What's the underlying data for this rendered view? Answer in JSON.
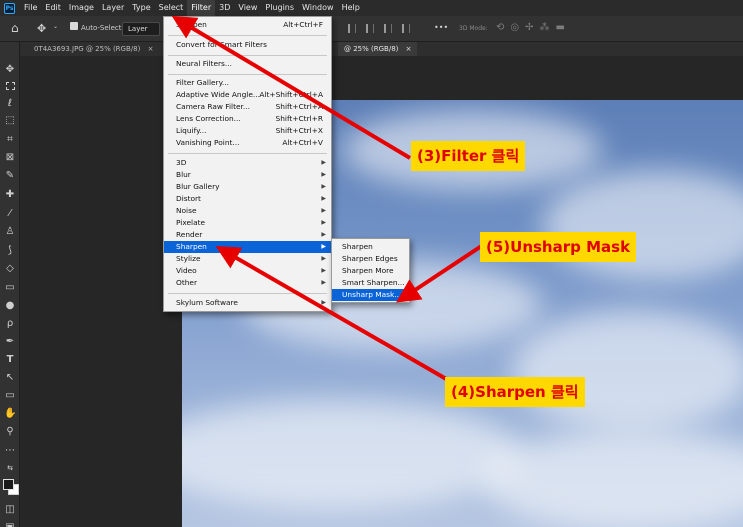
{
  "app": {
    "logo_text": "Ps"
  },
  "menubar": {
    "items": [
      "File",
      "Edit",
      "Image",
      "Layer",
      "Type",
      "Select",
      "Filter",
      "3D",
      "View",
      "Plugins",
      "Window",
      "Help"
    ]
  },
  "options_bar": {
    "auto_select_label": "Auto-Select:",
    "layer_select_value": "Layer",
    "three_d_mode_label": "3D Mode:",
    "more_label": "•••"
  },
  "tabs": {
    "left_tab": "0T4A3693.JPG @ 25% (RGB/8)",
    "left_tab_close": "×",
    "right_tab": "@ 25% (RGB/8)",
    "right_tab_close": "×"
  },
  "filter_menu": {
    "last_filter": {
      "label": "Sharpen",
      "shortcut": "Alt+Ctrl+F"
    },
    "convert": "Convert for Smart Filters",
    "neural": "Neural Filters...",
    "gallery": "Filter Gallery...",
    "adaptive": {
      "label": "Adaptive Wide Angle...",
      "shortcut": "Alt+Shift+Ctrl+A"
    },
    "camera_raw": {
      "label": "Camera Raw Filter...",
      "shortcut": "Shift+Ctrl+A"
    },
    "lens": {
      "label": "Lens Correction...",
      "shortcut": "Shift+Ctrl+R"
    },
    "liquify": {
      "label": "Liquify...",
      "shortcut": "Shift+Ctrl+X"
    },
    "vanishing": {
      "label": "Vanishing Point...",
      "shortcut": "Alt+Ctrl+V"
    },
    "groups": [
      "3D",
      "Blur",
      "Blur Gallery",
      "Distort",
      "Noise",
      "Pixelate",
      "Render",
      "Sharpen",
      "Stylize",
      "Video",
      "Other"
    ],
    "skylum": "Skylum Software"
  },
  "sharpen_submenu": [
    "Sharpen",
    "Sharpen Edges",
    "Sharpen More",
    "Smart Sharpen...",
    "Unsharp Mask..."
  ],
  "annotations": {
    "step3": "(3)Filter 클릭",
    "step4": "(4)Sharpen 클릭",
    "step5": "(5)Unsharp Mask"
  },
  "colors": {
    "menu_highlight": "#0a64d8",
    "annotation_bg": "#ffd800",
    "annotation_text": "#e00000",
    "arrow": "#e60000"
  }
}
